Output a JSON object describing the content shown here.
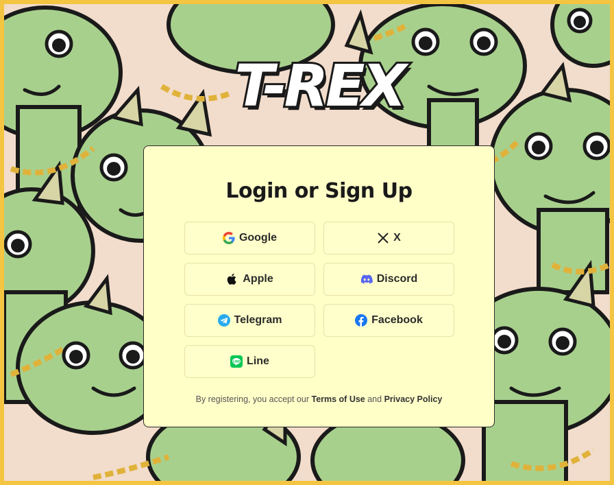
{
  "brand": {
    "logo_text": "T-REX"
  },
  "login": {
    "title": "Login or Sign Up",
    "buttons": [
      {
        "label": "Google",
        "icon": "google-icon"
      },
      {
        "label": "X",
        "icon": "x-icon"
      },
      {
        "label": "Apple",
        "icon": "apple-icon"
      },
      {
        "label": "Discord",
        "icon": "discord-icon"
      },
      {
        "label": "Telegram",
        "icon": "telegram-icon"
      },
      {
        "label": "Facebook",
        "icon": "facebook-icon"
      },
      {
        "label": "Line",
        "icon": "line-icon"
      }
    ],
    "footer": {
      "prefix": "By registering, you accept our",
      "terms": "Terms of Use",
      "and": "and",
      "privacy": "Privacy Policy"
    }
  },
  "colors": {
    "frame": "#f4c542",
    "card_bg": "#ffffc8",
    "dino_green": "#a8d08d",
    "background_pink": "#f2dccb",
    "outline": "#1a1a1a"
  }
}
